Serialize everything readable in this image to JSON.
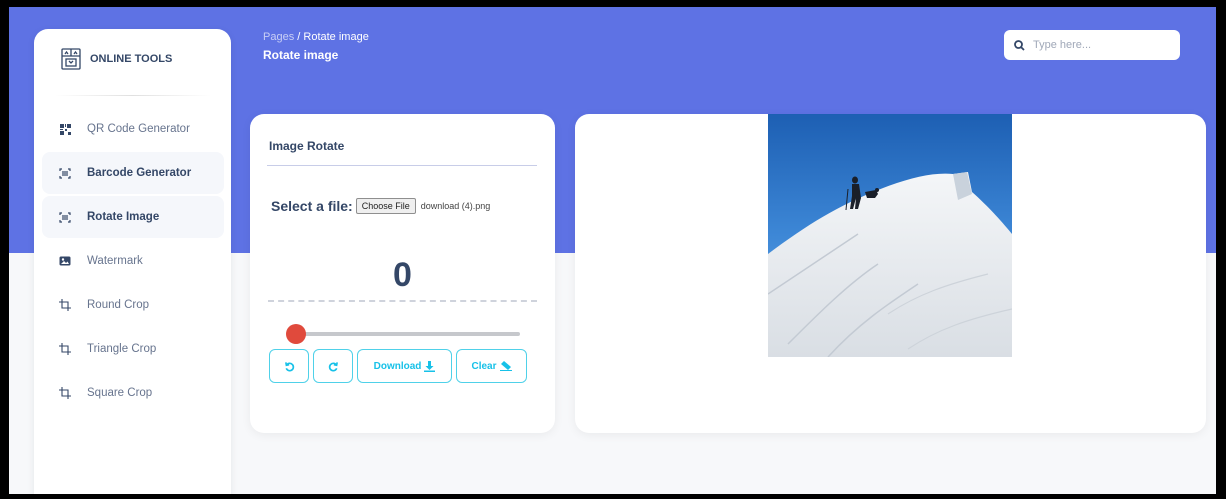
{
  "sidebar": {
    "brand": "ONLINE TOOLS",
    "items": [
      {
        "label": "QR Code Generator",
        "icon": "qr-icon",
        "active": false
      },
      {
        "label": "Barcode Generator",
        "icon": "barcode-scan-icon",
        "active": true
      },
      {
        "label": "Rotate Image",
        "icon": "barcode-scan-icon",
        "active": true
      },
      {
        "label": "Watermark",
        "icon": "image-icon",
        "active": false
      },
      {
        "label": "Round Crop",
        "icon": "crop-icon",
        "active": false
      },
      {
        "label": "Triangle Crop",
        "icon": "crop-icon",
        "active": false
      },
      {
        "label": "Square Crop",
        "icon": "crop-icon",
        "active": false
      }
    ]
  },
  "header": {
    "breadcrumb_parent": "Pages",
    "breadcrumb_sep": "/",
    "breadcrumb_current": "Rotate image",
    "title": "Rotate image"
  },
  "search": {
    "placeholder": "Type here..."
  },
  "rotate_card": {
    "title": "Image Rotate",
    "file_label": "Select a file:",
    "file_button": "Choose File",
    "file_name": "download (4).png",
    "angle": "0",
    "slider_value": 0,
    "download_label": "Download",
    "clear_label": "Clear"
  },
  "colors": {
    "primary": "#5e72e4",
    "accent": "#17c1e8",
    "slider_thumb": "#e04a3c",
    "text_dark": "#344767"
  }
}
